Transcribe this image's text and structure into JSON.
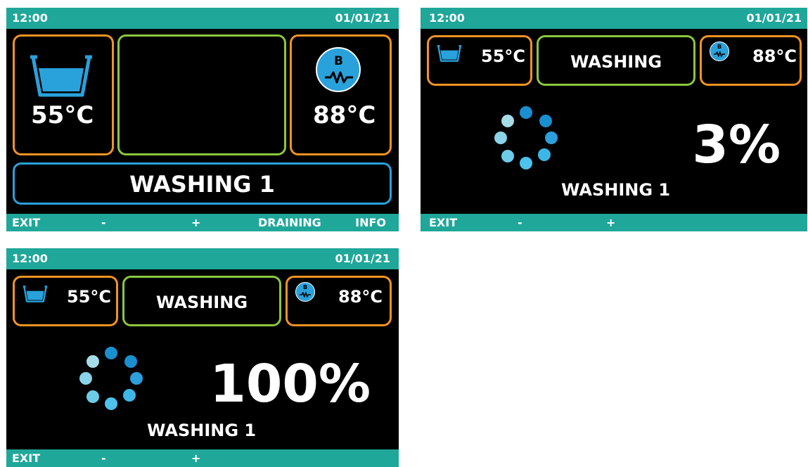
{
  "colors": {
    "teal": "#1fa79a",
    "orange": "#f39321",
    "green": "#8cc63f",
    "blue": "#29a1db",
    "dot_dark": "#1a8fd0",
    "dot_mid": "#3cb6e6",
    "dot_light": "#a6dbe8"
  },
  "screens": [
    {
      "time": "12:00",
      "date": "01/01/21",
      "tank_temp": "55°C",
      "boiler_temp": "88°C",
      "boiler_letter": "B",
      "program": "WASHING 1",
      "buttons": {
        "exit": "EXIT",
        "minus": "-",
        "plus": "+",
        "draining": "DRAINING",
        "info": "INFO"
      }
    },
    {
      "time": "12:00",
      "date": "01/01/21",
      "tank_temp": "55°C",
      "status": "WASHING",
      "boiler_temp": "88°C",
      "boiler_letter": "B",
      "progress_label": "3%",
      "progress_value": 3,
      "program": "WASHING 1",
      "buttons": {
        "exit": "EXIT",
        "minus": "-",
        "plus": "+"
      }
    },
    {
      "time": "12:00",
      "date": "01/01/21",
      "tank_temp": "55°C",
      "status": "WASHING",
      "boiler_temp": "88°C",
      "boiler_letter": "B",
      "progress_label": "100%",
      "progress_value": 100,
      "program": "WASHING 1",
      "buttons": {
        "exit": "EXIT",
        "minus": "-",
        "plus": "+"
      }
    }
  ],
  "icons": [
    "tank-icon",
    "boiler-heater-icon",
    "loading-spinner-icon"
  ]
}
